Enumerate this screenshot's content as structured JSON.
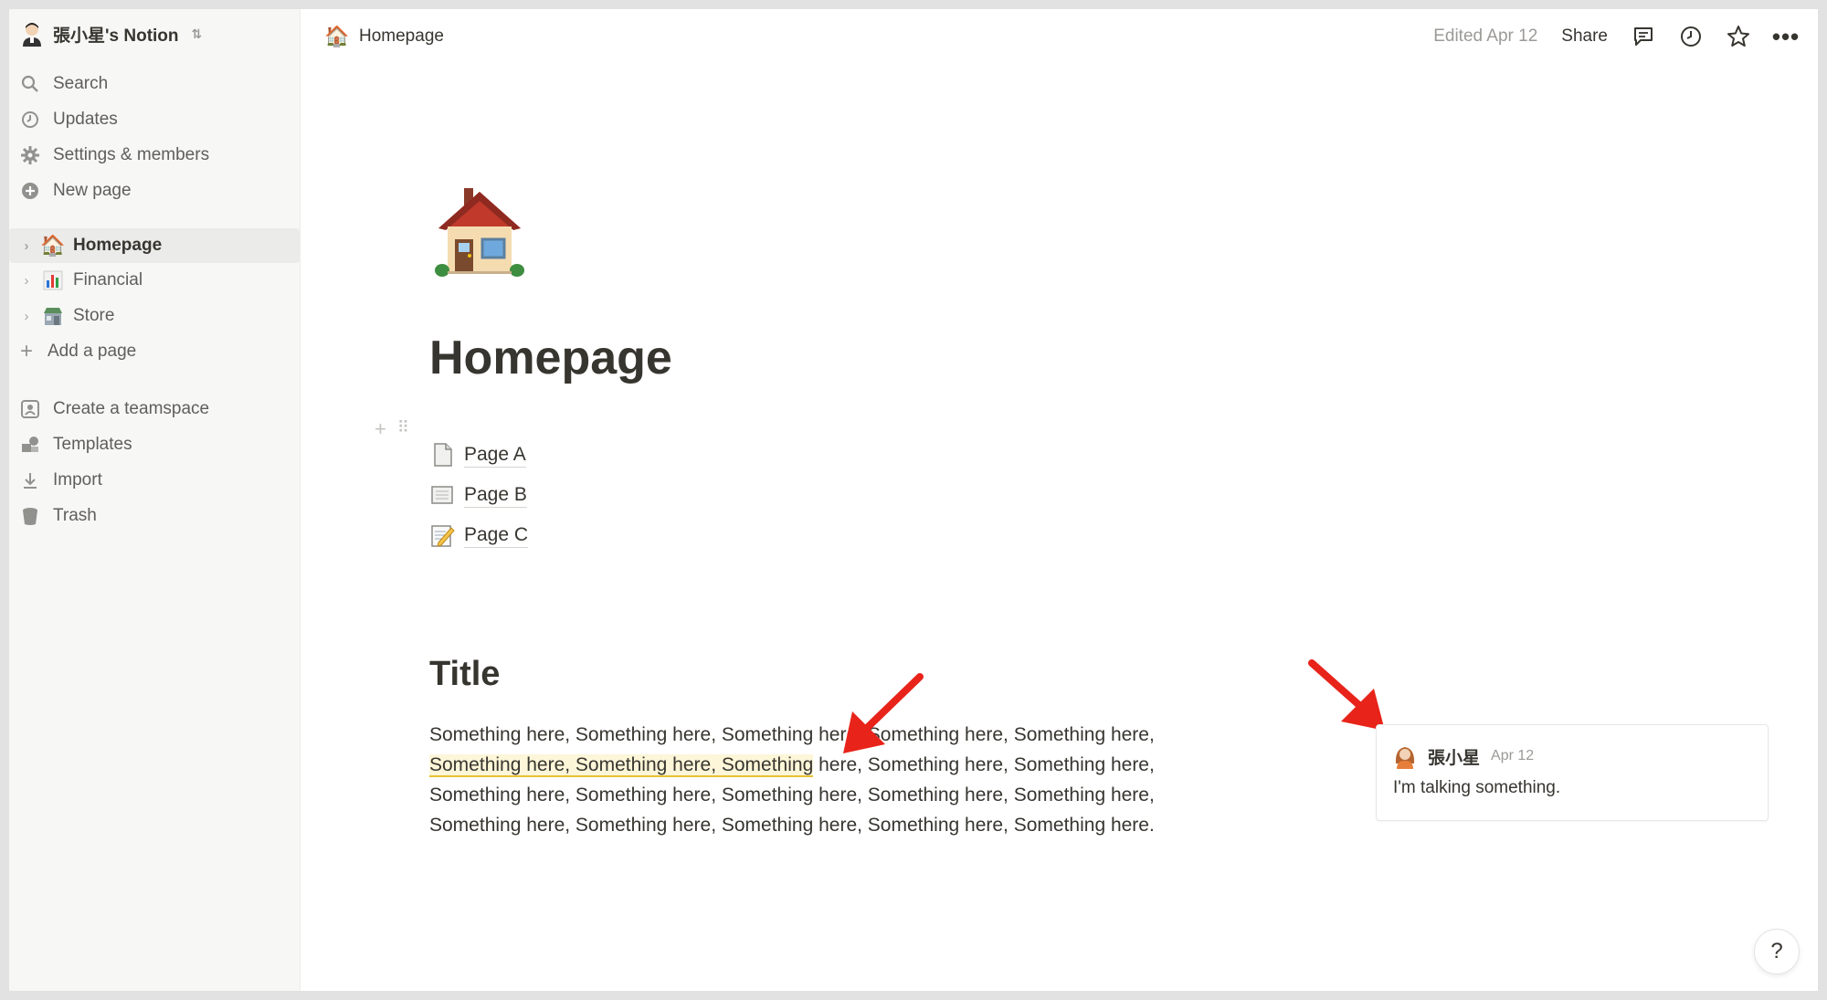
{
  "workspace": {
    "name": "張小星's Notion"
  },
  "sidebar": {
    "nav": [
      {
        "label": "Search",
        "icon": "search-icon"
      },
      {
        "label": "Updates",
        "icon": "clock-icon"
      },
      {
        "label": "Settings & members",
        "icon": "gear-icon"
      },
      {
        "label": "New page",
        "icon": "plus-circle-icon"
      }
    ],
    "pages": [
      {
        "label": "Homepage",
        "icon": "house-emoji",
        "active": true
      },
      {
        "label": "Financial",
        "icon": "bar-chart-emoji"
      },
      {
        "label": "Store",
        "icon": "store-emoji"
      }
    ],
    "add_page": "Add a page",
    "bottom": [
      {
        "label": "Create a teamspace",
        "icon": "teamspace-icon"
      },
      {
        "label": "Templates",
        "icon": "templates-icon"
      },
      {
        "label": "Import",
        "icon": "download-icon"
      },
      {
        "label": "Trash",
        "icon": "trash-icon"
      }
    ]
  },
  "topbar": {
    "breadcrumb": "Homepage",
    "edited": "Edited Apr 12",
    "share": "Share"
  },
  "page": {
    "title": "Homepage",
    "links": [
      "Page A",
      "Page B",
      "Page C"
    ],
    "section_title": "Title",
    "paragraph": {
      "before": "Something here, Something here, Something here, Something here, Something here,",
      "highlighted": "Something here, Something here, Something",
      "after": " here, Something here, Something here, Something here, Something here, Something here, Something here, Something here, Something here, Something here, Something here, Something here, Something here."
    }
  },
  "comment": {
    "author": "張小星",
    "date": "Apr 12",
    "body": "I'm talking something."
  },
  "help": "?",
  "colors": {
    "sidebar_bg": "#f7f7f5",
    "text": "#37352f",
    "muted": "#9b9a97",
    "highlight_bg": "#fdf6d8",
    "highlight_underline": "#e8c233",
    "arrow": "#e8231a"
  }
}
